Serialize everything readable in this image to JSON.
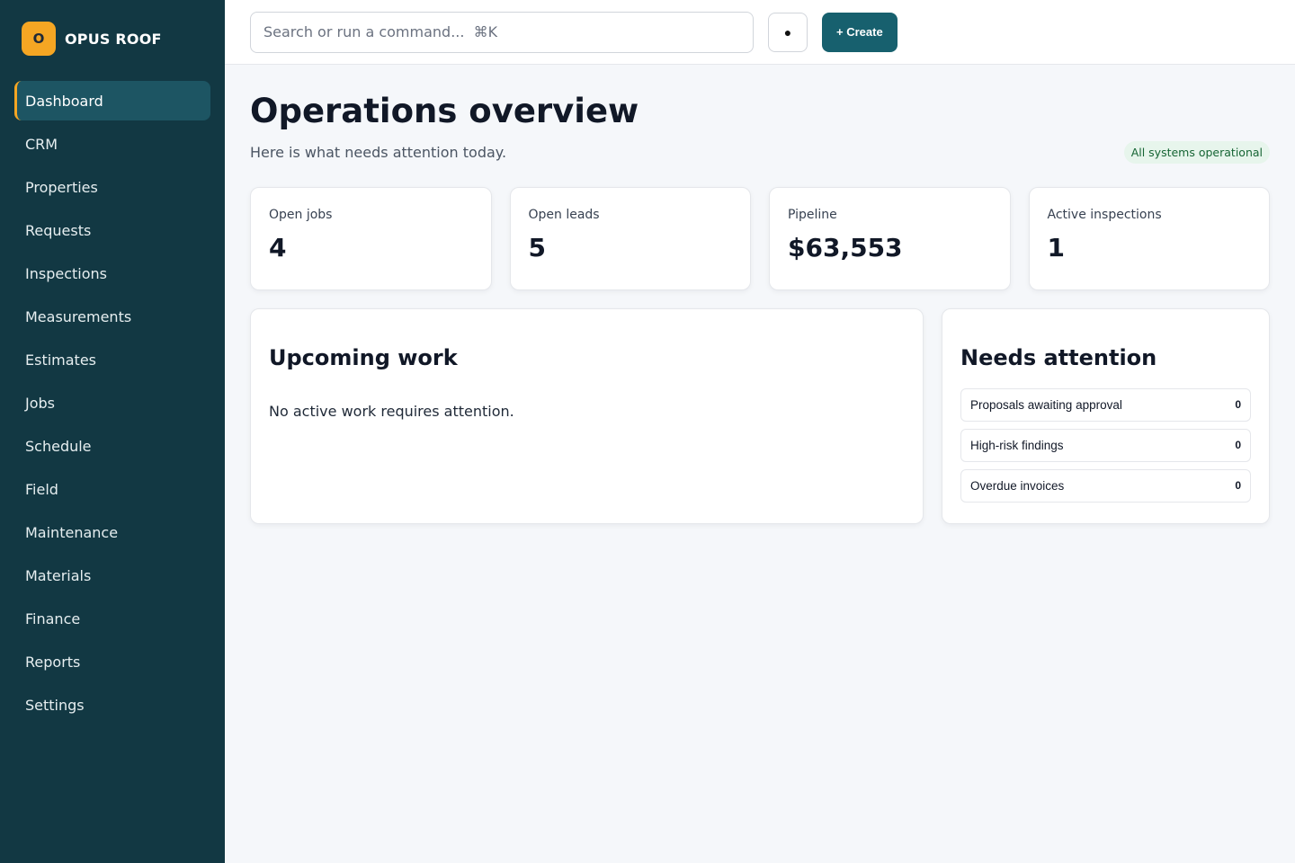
{
  "brand": {
    "mark": "O",
    "name": "OPUS ROOF"
  },
  "sidebar": {
    "items": [
      {
        "label": "Dashboard",
        "active": true
      },
      {
        "label": "CRM"
      },
      {
        "label": "Properties"
      },
      {
        "label": "Requests"
      },
      {
        "label": "Inspections"
      },
      {
        "label": "Measurements"
      },
      {
        "label": "Estimates"
      },
      {
        "label": "Jobs"
      },
      {
        "label": "Schedule"
      },
      {
        "label": "Field"
      },
      {
        "label": "Maintenance"
      },
      {
        "label": "Materials"
      },
      {
        "label": "Finance"
      },
      {
        "label": "Reports"
      },
      {
        "label": "Settings"
      }
    ]
  },
  "topbar": {
    "search_placeholder": "Search or run a command...  ⌘K",
    "theme_glyph": "●",
    "create_label": "+ Create"
  },
  "page": {
    "title": "Operations overview",
    "subtitle": "Here is what needs attention today.",
    "status_badge": "All systems operational"
  },
  "stats": [
    {
      "label": "Open jobs",
      "value": "4"
    },
    {
      "label": "Open leads",
      "value": "5"
    },
    {
      "label": "Pipeline",
      "value": "$63,553"
    },
    {
      "label": "Active inspections",
      "value": "1"
    }
  ],
  "upcoming": {
    "title": "Upcoming work",
    "empty_message": "No active work requires attention."
  },
  "attention": {
    "title": "Needs attention",
    "items": [
      {
        "label": "Proposals awaiting approval",
        "count": "0"
      },
      {
        "label": "High-risk findings",
        "count": "0"
      },
      {
        "label": "Overdue invoices",
        "count": "0"
      }
    ]
  },
  "colors": {
    "sidebar_bg": "#123843",
    "sidebar_active_bg": "#1d5563",
    "brand_accent": "#f5a623",
    "primary_button": "#17606e",
    "status_badge_bg": "#e7f5ec",
    "status_badge_text": "#166534"
  }
}
